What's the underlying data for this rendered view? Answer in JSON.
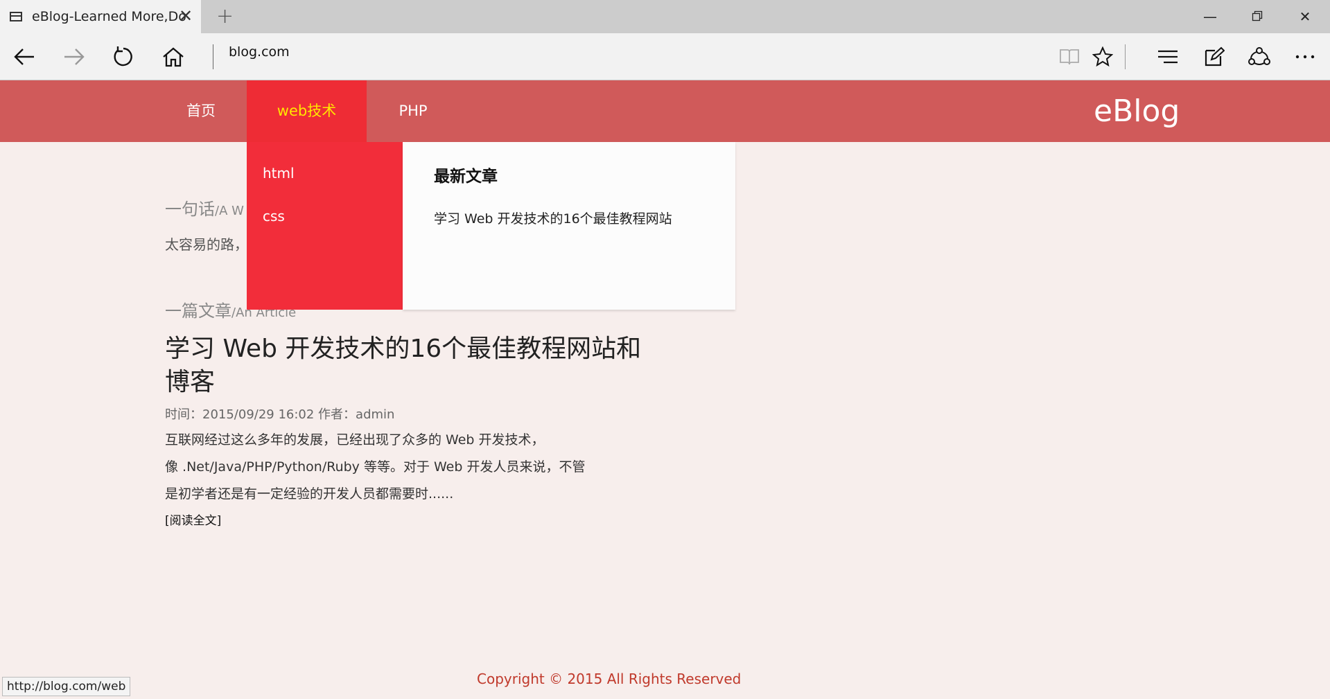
{
  "browser": {
    "tab_title": "eBlog-Learned More,Do",
    "address": "blog.com",
    "status_url": "http://blog.com/web"
  },
  "site": {
    "brand": "eBlog",
    "nav": [
      {
        "label": "首页"
      },
      {
        "label": "web技术",
        "active": true
      },
      {
        "label": "PHP"
      }
    ],
    "dropdown": {
      "items": [
        "html",
        "css"
      ],
      "latest_heading": "最新文章",
      "latest_link": "学习 Web 开发技术的16个最佳教程网站"
    },
    "sections": {
      "quote_title": "一句话",
      "quote_title_en": "/A W",
      "quote_text": "太容易的路，",
      "article_title": "一篇文章",
      "article_title_en": "/An Article"
    },
    "article": {
      "title": "学习 Web 开发技术的16个最佳教程网站和博客",
      "meta": "时间：2015/09/29 16:02  作者：admin",
      "body_lines": [
        "互联网经过这么多年的发展，已经出现了众多的 Web 开发技术，",
        "像 .Net/Java/PHP/Python/Ruby 等等。对于 Web 开发人员来说，不管",
        "是初学者还是有一定经验的开发人员都需要时......"
      ],
      "read_more": "[阅读全文]"
    },
    "footer": "Copyright © 2015 All Rights Reserved"
  },
  "colors": {
    "nav_bg": "#d05a5a",
    "nav_active_bg": "#ee2c35",
    "nav_active_text": "#ffe600",
    "dropdown_bg": "#f22d3a",
    "footer_text": "#c0392b"
  }
}
